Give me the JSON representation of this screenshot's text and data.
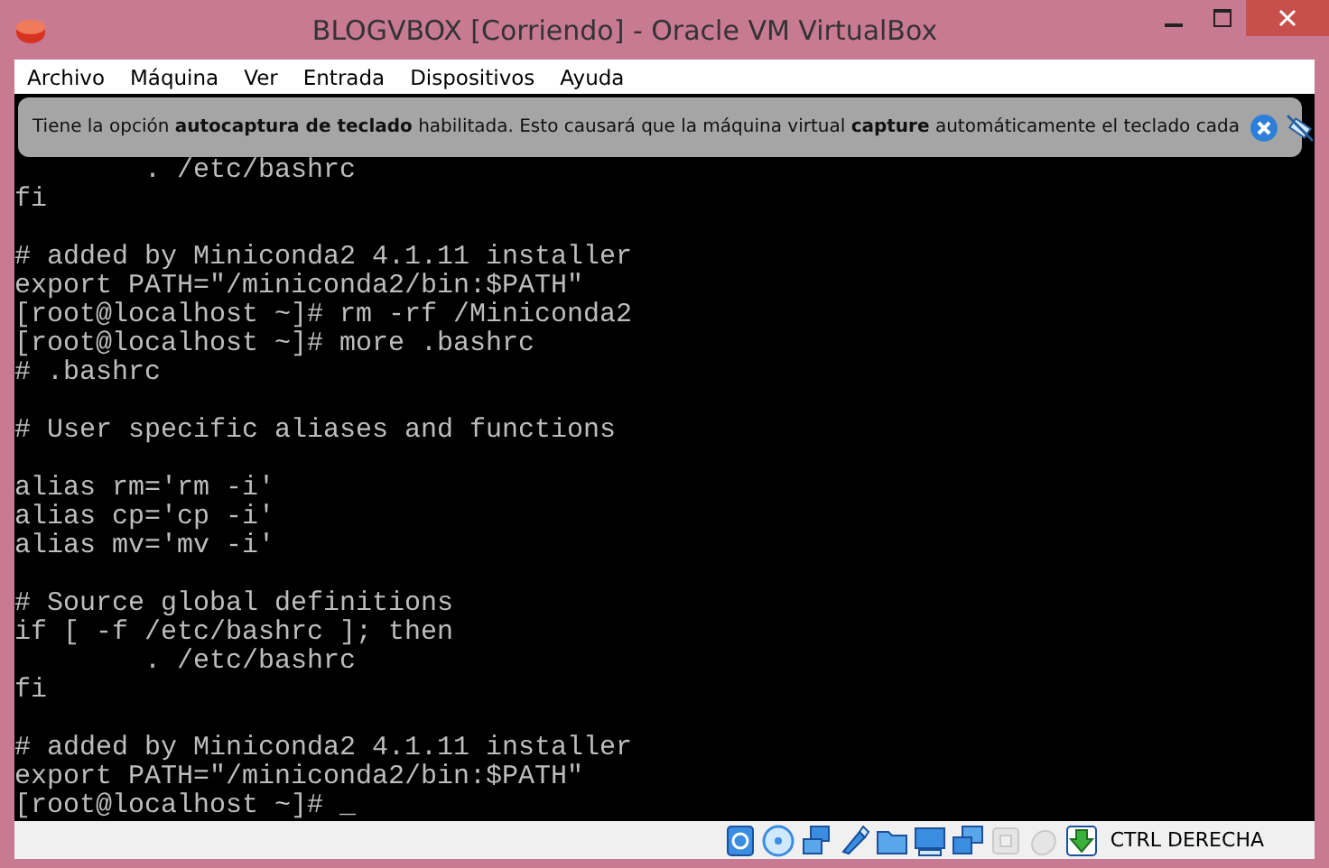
{
  "window": {
    "title": "BLOGVBOX [Corriendo] - Oracle VM VirtualBox"
  },
  "menu": [
    "Archivo",
    "Máquina",
    "Ver",
    "Entrada",
    "Dispositivos",
    "Ayuda"
  ],
  "notification": {
    "message": "Tiene la opción **autocaptura de teclado** habilitada. Esto causará que la máquina virtual **capture** automáticamente el teclado cada"
  },
  "terminal": {
    "blocks": [
      [
        "        . /etc/bashrc",
        "fi"
      ],
      [
        "# added by Miniconda2 4.1.11 installer",
        "export PATH=\"/miniconda2/bin:$PATH\"",
        "[root@localhost ~]# rm -rf /Miniconda2",
        "[root@localhost ~]# more .bashrc",
        "# .bashrc"
      ],
      [
        "# User specific aliases and functions"
      ],
      [
        "alias rm='rm -i'",
        "alias cp='cp -i'",
        "alias mv='mv -i'"
      ],
      [
        "# Source global definitions",
        "if [ -f /etc/bashrc ]; then",
        "        . /etc/bashrc",
        "fi"
      ],
      [
        "# added by Miniconda2 4.1.11 installer",
        "export PATH=\"/miniconda2/bin:$PATH\"",
        "[root@localhost ~]# _"
      ]
    ]
  },
  "status_bar": {
    "devices": [
      {
        "kind": "hdd",
        "disabled": false
      },
      {
        "kind": "optical",
        "disabled": false
      },
      {
        "kind": "network",
        "disabled": false
      },
      {
        "kind": "usb",
        "disabled": false
      },
      {
        "kind": "folder",
        "disabled": false
      },
      {
        "kind": "display",
        "disabled": false
      },
      {
        "kind": "capture",
        "disabled": false
      },
      {
        "kind": "cpu",
        "disabled": true
      },
      {
        "kind": "mouse",
        "disabled": true
      },
      {
        "kind": "hostkey",
        "disabled": false
      }
    ],
    "host_key": "CTRL DERECHA"
  }
}
